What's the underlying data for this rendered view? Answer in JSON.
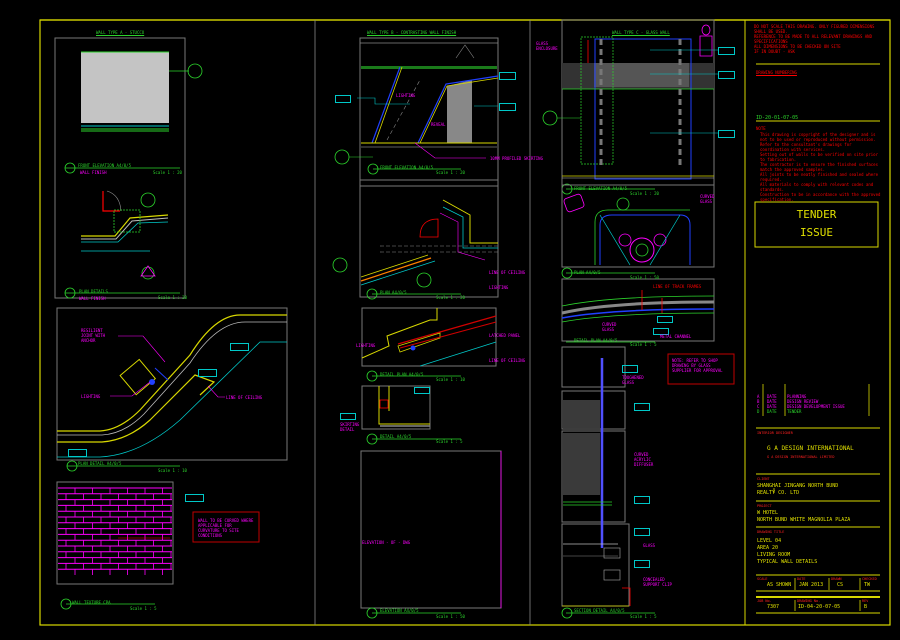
{
  "sheet": {
    "stamp": [
      "TENDER",
      "ISSUE"
    ],
    "colors": {
      "border": "#d8d800",
      "annot": "#ff00ff",
      "tag": "#00c8c8",
      "title": "#2cd42c",
      "notes": "#ff0000"
    }
  },
  "views": {
    "v1": {
      "title": "WALL TYPE A - STUCCO",
      "caption": "FRONT ELEVATION A4/0/5",
      "sub": "WALL FINISH",
      "scale": "Scale 1 : 20",
      "tag": "03"
    },
    "v2": {
      "caption": "PLAN DETAILS",
      "sub": "WALL FINISH",
      "scale": "Scale 1 : 20",
      "tag": "01"
    },
    "v3": {
      "caption": "PLAN DETAIL A4/0/5",
      "scale": "Scale 1 : 10",
      "tag": "02",
      "labels": [
        "RESILIENT JOINT WITH ANCHOR",
        "LIGHTING",
        "LINE OF CEILING"
      ]
    },
    "v4": {
      "caption": "WALL TEXTURE CPA",
      "scale": "Scale 1 : 5",
      "tag": "04",
      "note": "WALL TO BE CURVED WHERE APPLICABLE FOR CURVATURE TO SITE CONDITIONS"
    },
    "v5": {
      "title": "WALL TYPE B - CONTRASTING WALL FINISH",
      "caption": "FRONT ELEVATION A4/0/5",
      "scale": "Scale 1 : 20",
      "tag": "05",
      "labels": [
        "LIGHTING",
        "REVEAL",
        "10MM PROFILED SKIRTING"
      ]
    },
    "v6": {
      "caption": "PLAN A4/0/5",
      "scale": "Scale 1 : 20",
      "tag": "06",
      "labels": [
        "LINE OF CEILING",
        "LIGHTING"
      ]
    },
    "v7": {
      "caption": "DETAIL PLAN A4/0/5",
      "scale": "Scale 1 : 10",
      "tag": "07",
      "labels": [
        "LIGHTING",
        "LATCHED PANEL",
        "LINE OF CEILING"
      ]
    },
    "v8": {
      "caption": "DETAIL A4/0/5",
      "scale": "Scale 1 : 5",
      "tag": "08",
      "labels": [
        "SKIRTING DETAIL"
      ]
    },
    "v9": {
      "caption": "ELEVATION A4/0/5",
      "scale": "Scale 1 : 50",
      "tag": "09",
      "labels": [
        "ELEVATION - OF - DWG"
      ]
    },
    "v10": {
      "title": "WALL TYPE C - GLASS WALL",
      "caption": "FRONT ELEVATION A4/0/5",
      "scale": "Scale 1 : 20",
      "tag": "10",
      "labels": [
        "GLASS ENCLOSURE",
        "CURVED GLASS"
      ]
    },
    "v11": {
      "caption": "PLAN A4/0/5",
      "scale": "Scale 1 : 50",
      "tag": "11"
    },
    "v12": {
      "caption": "DETAIL PLAN A4/0/5",
      "scale": "Scale 1 : 5",
      "tag": "12",
      "labels": [
        "CURVED GLASS",
        "METAL CHANNEL",
        "LINE OF TRACK FRAMES"
      ]
    },
    "v13": {
      "caption": "SECTION DETAIL A4/0/5",
      "scale": "Scale 1 : 5",
      "tag": "13",
      "labels": [
        "TOUGHENED GLASS",
        "CURVED ACRYLIC DIFFUSER",
        "GLASS",
        "CONCEALED SUPPORT CLIP"
      ],
      "note": "NOTE: REFER TO SHOP DRAWING BY GLASS SUPPLIER FOR APPROVAL"
    }
  },
  "notes": {
    "header": [
      "DO NOT SCALE THIS DRAWING. ONLY FIGURED DIMENSIONS SHALL BE USED.",
      "REFERENCE TO BE MADE TO ALL RELEVANT DRAWINGS AND SPECIFICATIONS",
      "ALL DIMENSIONS TO BE CHECKED ON SITE",
      "IF IN DOUBT - ASK"
    ],
    "legend_title": "DRAWING NUMBERING",
    "numbering": "ID-20-01-07-05",
    "notes_title": "NOTE",
    "items": [
      "This drawing is copyright of the designer and is not to be used or reproduced without permission.",
      "Refer to the consultant's drawings for coordination with services.",
      "Setting out of walls to be verified on site prior to fabrication.",
      "The contractor is to ensure the finished surfaces match the approved samples.",
      "All joints to be neatly finished and sealed where required.",
      "All materials to comply with relevant codes and standards.",
      "Construction to be in accordance with the approved specification."
    ]
  },
  "revisions": [
    {
      "rev": "A",
      "date": "DATE",
      "desc": "PLANNING"
    },
    {
      "rev": "B",
      "date": "DATE",
      "desc": "DESIGN REVIEW"
    },
    {
      "rev": "C",
      "date": "DATE",
      "desc": "DESIGN DEVELOPMENT ISSUE"
    },
    {
      "rev": "D",
      "date": "DATE",
      "desc": "TENDER"
    }
  ],
  "title_block": {
    "firm_label": "INTERIOR DESIGNER",
    "firm": "G A DESIGN INTERNATIONAL",
    "firm_address": "G A DESIGN INTERNATIONAL LIMITED",
    "client_label": "CLIENT",
    "client": [
      "SHANGHAI JINGANG NORTH BUND",
      "REALTY CO. LTD"
    ],
    "project_label": "PROJECT",
    "project": [
      "W HOTEL",
      "NORTH BUND WHITE MAGNOLIA PLAZA"
    ],
    "drawing_label": "DRAWING TITLE",
    "drawing": [
      "LEVEL 04",
      "AREA 20",
      "LIVING ROOM",
      "TYPICAL WALL DETAILS"
    ],
    "scale_label": "SCALE",
    "scale": "AS SHOWN",
    "date_label": "DATE",
    "date": "JAN 2013",
    "drawn_label": "DRAWN",
    "drawn": "CS",
    "checked_label": "CHECKED",
    "checked": "TW",
    "job_label": "JOB No.",
    "job": "7307",
    "dwg_label": "DRAWING No.",
    "dwg": "ID-04-20-07-05",
    "rev_label": "REV",
    "rev": "B"
  }
}
